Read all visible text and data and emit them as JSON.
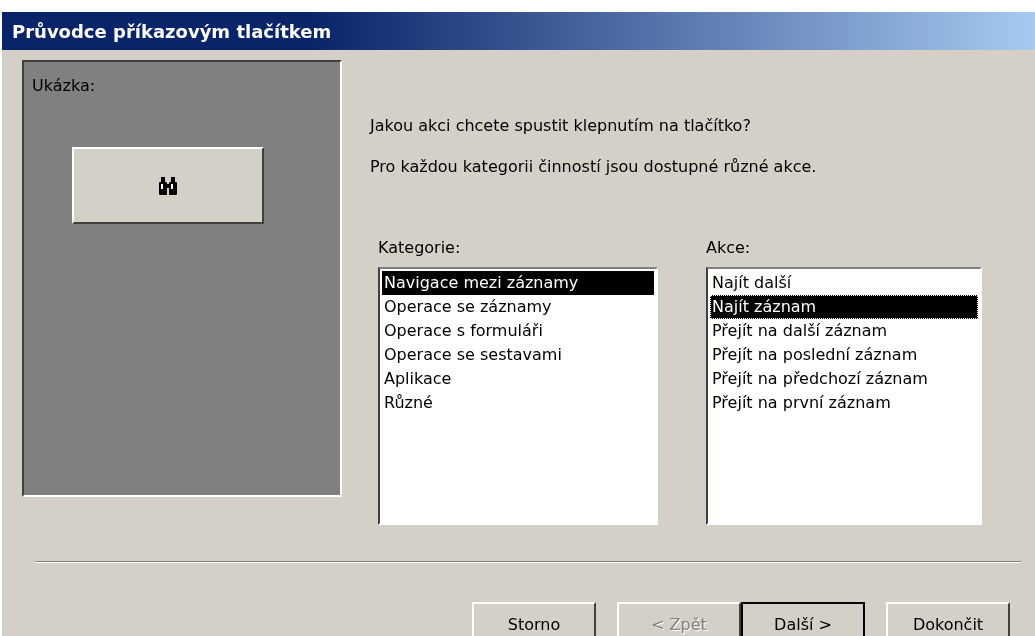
{
  "window": {
    "title": "Průvodce příkazovým tlačítkem"
  },
  "preview": {
    "label": "Ukázka:"
  },
  "question": "Jakou akci chcete spustit klepnutím na tlačítko?",
  "hint": "Pro každou kategorii činností jsou dostupné různé akce.",
  "categories": {
    "label": "Kategorie:",
    "items": [
      {
        "label": "Navigace mezi záznamy",
        "selected": true
      },
      {
        "label": "Operace se záznamy",
        "selected": false
      },
      {
        "label": "Operace s formuláři",
        "selected": false
      },
      {
        "label": "Operace se sestavami",
        "selected": false
      },
      {
        "label": "Aplikace",
        "selected": false
      },
      {
        "label": "Různé",
        "selected": false
      }
    ]
  },
  "actions": {
    "label": "Akce:",
    "items": [
      {
        "label": "Najít další",
        "selected": false
      },
      {
        "label": "Najít záznam",
        "selected": true
      },
      {
        "label": "Přejít na další záznam",
        "selected": false
      },
      {
        "label": "Přejít na poslední záznam",
        "selected": false
      },
      {
        "label": "Přejít na předchozí záznam",
        "selected": false
      },
      {
        "label": "Přejít na první záznam",
        "selected": false
      }
    ]
  },
  "buttons": [
    {
      "label": "Storno",
      "disabled": false,
      "default": false
    },
    {
      "label": "< Zpět",
      "disabled": true,
      "default": false
    },
    {
      "label": "Další >",
      "disabled": false,
      "default": true
    },
    {
      "label": "Dokončit",
      "disabled": false,
      "default": false
    }
  ]
}
